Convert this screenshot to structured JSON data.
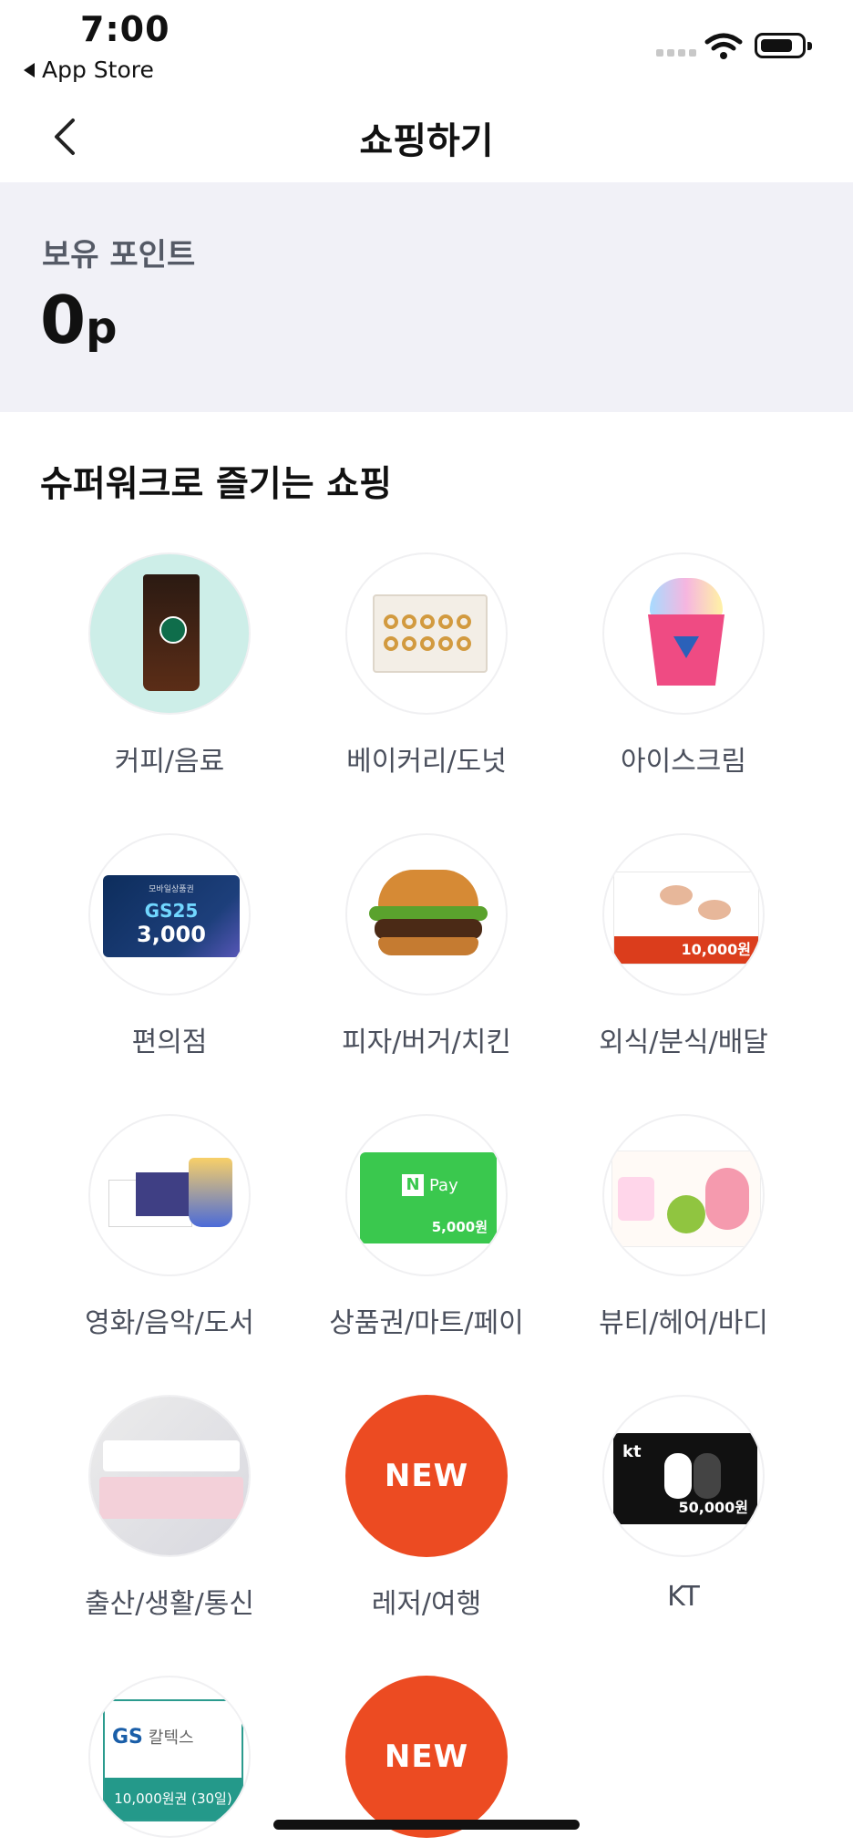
{
  "status_bar": {
    "time": "7:00",
    "back_app": "App Store"
  },
  "nav": {
    "title": "쇼핑하기"
  },
  "points": {
    "label": "보유 포인트",
    "value": "0",
    "unit": "p"
  },
  "section": {
    "title": "슈퍼워크로 즐기는 쇼핑"
  },
  "categories": [
    {
      "label": "커피/음료",
      "icon": "coffee-image"
    },
    {
      "label": "베이커리/도넛",
      "icon": "donut-box-image"
    },
    {
      "label": "아이스크림",
      "icon": "ice-cream-image"
    },
    {
      "label": "편의점",
      "icon": "gs25-card-image"
    },
    {
      "label": "피자/버거/치킨",
      "icon": "burger-image"
    },
    {
      "label": "외식/분식/배달",
      "icon": "meal-voucher-image"
    },
    {
      "label": "영화/음악/도서",
      "icon": "movie-ticket-image"
    },
    {
      "label": "상품권/마트/페이",
      "icon": "npay-card-image"
    },
    {
      "label": "뷰티/헤어/바디",
      "icon": "oliveyoung-card-image"
    },
    {
      "label": "출산/생활/통신",
      "icon": "towel-image"
    },
    {
      "label": "레저/여행",
      "icon": "new-badge"
    },
    {
      "label": "KT",
      "icon": "kt-card-image"
    },
    {
      "label": "",
      "icon": "gs-caltex-card-image"
    },
    {
      "label": "",
      "icon": "new-badge"
    }
  ],
  "card_texts": {
    "gs25_top": "모바일상품권",
    "gs25_brand": "GS25",
    "gs25_amount": "3,000",
    "meal_price": "10,000원",
    "npay_logo": "N",
    "npay_text": "Pay",
    "npay_amount": "5,000원",
    "kt_logo": "kt",
    "kt_amount": "50,000원",
    "gs_caltex_brand": "GS",
    "gs_caltex_name": "칼텍스",
    "gs_caltex_amount": "10,000원권 (30일)",
    "new_badge": "NEW"
  },
  "colors": {
    "accent_new": "#ec4b22",
    "points_bg": "#f1f1f7"
  }
}
